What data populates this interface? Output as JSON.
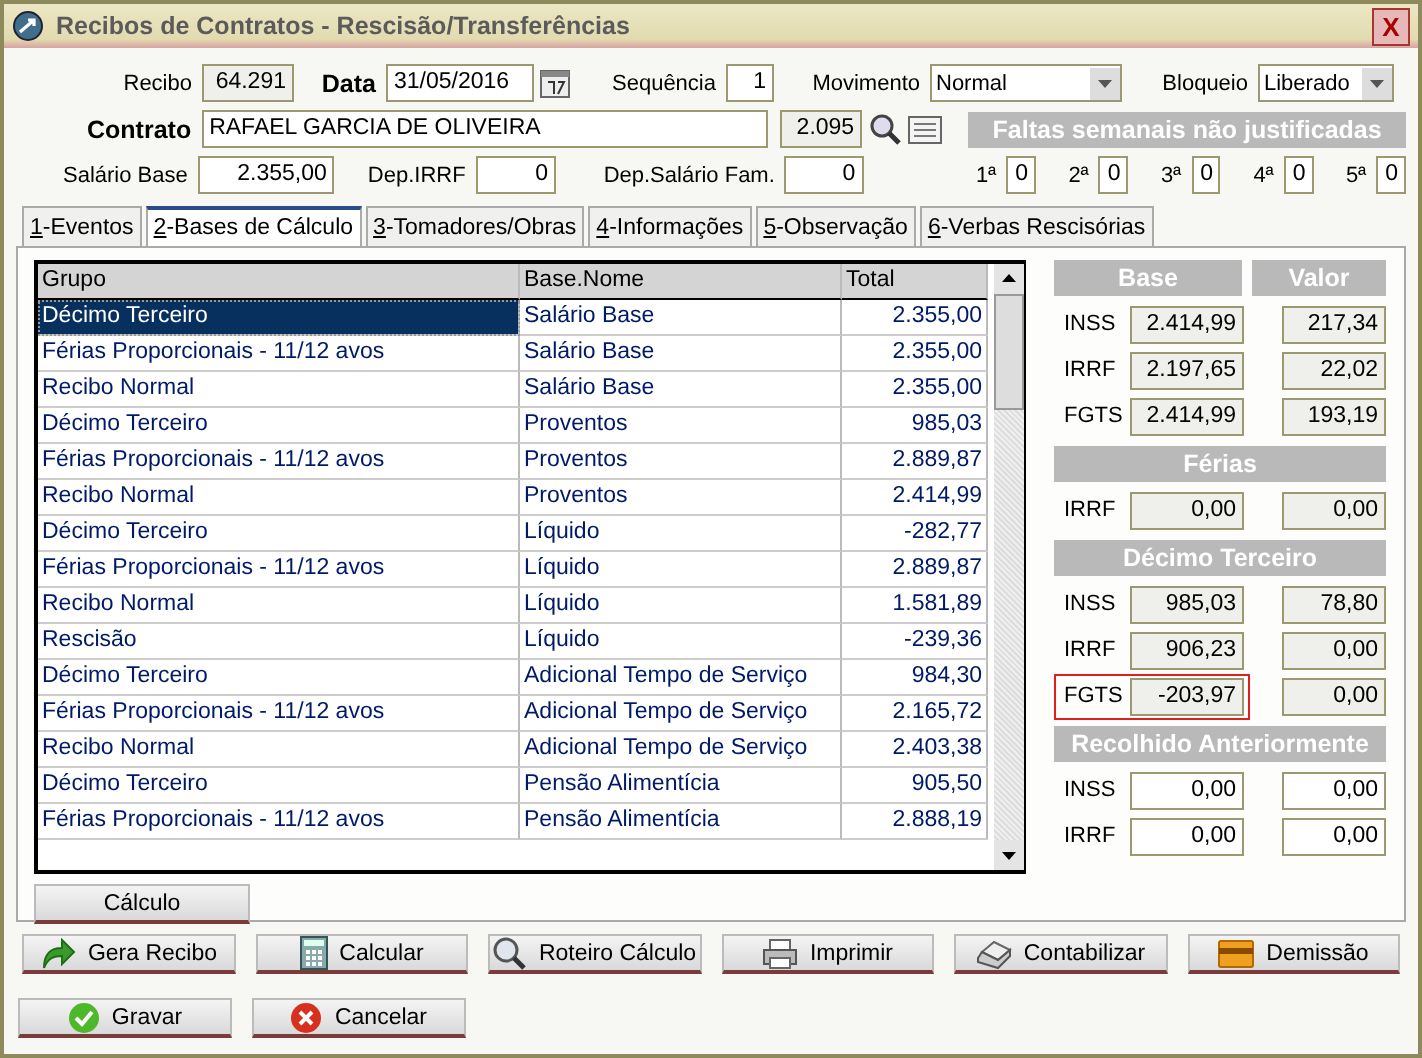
{
  "window": {
    "title": "Recibos de Contratos - Rescisão/Transferências",
    "close": "X"
  },
  "header": {
    "recibo_label": "Recibo",
    "recibo": "64.291",
    "data_label": "Data",
    "data": "31/05/2016",
    "sequencia_label": "Sequência",
    "sequencia": "1",
    "movimento_label": "Movimento",
    "movimento": "Normal",
    "bloqueio_label": "Bloqueio",
    "bloqueio": "Liberado",
    "contrato_label": "Contrato",
    "contrato": "RAFAEL GARCIA DE OLIVEIRA",
    "contrato_codigo": "2.095",
    "salario_label": "Salário Base",
    "salario": "2.355,00",
    "dep_irrf_label": "Dep.IRRF",
    "dep_irrf": "0",
    "dep_fam_label": "Dep.Salário Fam.",
    "dep_fam": "0"
  },
  "faltas": {
    "title": "Faltas semanais não justificadas",
    "weeks": [
      {
        "label": "1ª",
        "value": "0"
      },
      {
        "label": "2ª",
        "value": "0"
      },
      {
        "label": "3ª",
        "value": "0"
      },
      {
        "label": "4ª",
        "value": "0"
      },
      {
        "label": "5ª",
        "value": "0"
      }
    ]
  },
  "tabs": [
    {
      "key": "1",
      "label": "-Eventos",
      "selected": false
    },
    {
      "key": "2",
      "label": "-Bases de Cálculo",
      "selected": true
    },
    {
      "key": "3",
      "label": "-Tomadores/Obras",
      "selected": false
    },
    {
      "key": "4",
      "label": "-Informações",
      "selected": false
    },
    {
      "key": "5",
      "label": "-Observação",
      "selected": false
    },
    {
      "key": "6",
      "label": "-Verbas Rescisórias",
      "selected": false
    }
  ],
  "table": {
    "columns": [
      "Grupo",
      "Base.Nome",
      "Total"
    ],
    "rows": [
      {
        "cells": [
          "Décimo Terceiro",
          "Salário Base",
          "2.355,00"
        ],
        "selected": true
      },
      {
        "cells": [
          "Férias Proporcionais - 11/12 avos",
          "Salário Base",
          "2.355,00"
        ],
        "selected": false
      },
      {
        "cells": [
          "Recibo Normal",
          "Salário Base",
          "2.355,00"
        ],
        "selected": false
      },
      {
        "cells": [
          "Décimo Terceiro",
          "Proventos",
          "985,03"
        ],
        "selected": false
      },
      {
        "cells": [
          "Férias Proporcionais - 11/12 avos",
          "Proventos",
          "2.889,87"
        ],
        "selected": false
      },
      {
        "cells": [
          "Recibo Normal",
          "Proventos",
          "2.414,99"
        ],
        "selected": false
      },
      {
        "cells": [
          "Décimo Terceiro",
          "Líquido",
          "-282,77"
        ],
        "selected": false
      },
      {
        "cells": [
          "Férias Proporcionais - 11/12 avos",
          "Líquido",
          "2.889,87"
        ],
        "selected": false
      },
      {
        "cells": [
          "Recibo Normal",
          "Líquido",
          "1.581,89"
        ],
        "selected": false
      },
      {
        "cells": [
          "Rescisão",
          "Líquido",
          "-239,36"
        ],
        "selected": false
      },
      {
        "cells": [
          "Décimo Terceiro",
          "Adicional Tempo de Serviço",
          "984,30"
        ],
        "selected": false
      },
      {
        "cells": [
          "Férias Proporcionais - 11/12 avos",
          "Adicional Tempo de Serviço",
          "2.165,72"
        ],
        "selected": false
      },
      {
        "cells": [
          "Recibo Normal",
          "Adicional Tempo de Serviço",
          "2.403,38"
        ],
        "selected": false
      },
      {
        "cells": [
          "Décimo Terceiro",
          "Pensão Alimentícia",
          "905,50"
        ],
        "selected": false
      },
      {
        "cells": [
          "Férias Proporcionais - 11/12 avos",
          "Pensão Alimentícia",
          "2.888,19"
        ],
        "selected": false
      }
    ]
  },
  "summary": {
    "base_header": "Base",
    "valor_header": "Valor",
    "sections": [
      {
        "rows": [
          {
            "label": "INSS",
            "base": "2.414,99",
            "valor": "217,34",
            "highlighted": false,
            "editable": false
          },
          {
            "label": "IRRF",
            "base": "2.197,65",
            "valor": "22,02",
            "highlighted": false,
            "editable": false
          },
          {
            "label": "FGTS",
            "base": "2.414,99",
            "valor": "193,19",
            "highlighted": false,
            "editable": false
          }
        ]
      },
      {
        "title": "Férias",
        "rows": [
          {
            "label": "IRRF",
            "base": "0,00",
            "valor": "0,00",
            "highlighted": false,
            "editable": false
          }
        ]
      },
      {
        "title": "Décimo Terceiro",
        "rows": [
          {
            "label": "INSS",
            "base": "985,03",
            "valor": "78,80",
            "highlighted": false,
            "editable": false
          },
          {
            "label": "IRRF",
            "base": "906,23",
            "valor": "0,00",
            "highlighted": false,
            "editable": false
          },
          {
            "label": "FGTS",
            "base": "-203,97",
            "valor": "0,00",
            "highlighted": true,
            "editable": false
          }
        ]
      },
      {
        "title": "Recolhido Anteriormente",
        "rows": [
          {
            "label": "INSS",
            "base": "0,00",
            "valor": "0,00",
            "highlighted": false,
            "editable": true
          },
          {
            "label": "IRRF",
            "base": "0,00",
            "valor": "0,00",
            "highlighted": false,
            "editable": true
          }
        ]
      }
    ]
  },
  "calculo_button": "Cálculo",
  "actions": [
    {
      "label": "Gera Recibo",
      "kind": "arrow"
    },
    {
      "label": "Calcular",
      "kind": "calculator"
    },
    {
      "label": "Roteiro Cálculo",
      "kind": "magnifier"
    },
    {
      "label": "Imprimir",
      "kind": "printer"
    },
    {
      "label": "Contabilizar",
      "kind": "register"
    },
    {
      "label": "Demissão",
      "kind": "card"
    }
  ],
  "footer": [
    {
      "label": "Gravar",
      "kind": "ok"
    },
    {
      "label": "Cancelar",
      "kind": "cancel"
    }
  ]
}
